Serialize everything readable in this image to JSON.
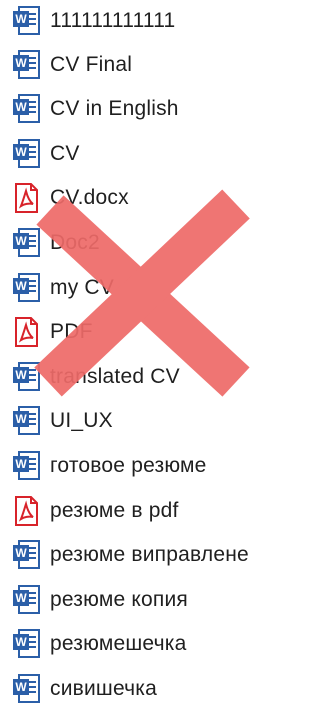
{
  "files": [
    {
      "name": "111111111111",
      "type": "word"
    },
    {
      "name": "CV Final",
      "type": "word"
    },
    {
      "name": "CV in English",
      "type": "word"
    },
    {
      "name": "CV",
      "type": "word"
    },
    {
      "name": "CV.docx",
      "type": "pdf"
    },
    {
      "name": "Doc2",
      "type": "word"
    },
    {
      "name": "my CV",
      "type": "word"
    },
    {
      "name": "PDF",
      "type": "pdf"
    },
    {
      "name": "translated CV",
      "type": "word"
    },
    {
      "name": "UI_UX",
      "type": "word"
    },
    {
      "name": "готовое резюме",
      "type": "word"
    },
    {
      "name": "резюме в pdf",
      "type": "pdf"
    },
    {
      "name": "резюме виправлене",
      "type": "word"
    },
    {
      "name": "резюме копия",
      "type": "word"
    },
    {
      "name": "резюмешечка",
      "type": "word"
    },
    {
      "name": "сивишечка",
      "type": "word"
    }
  ],
  "overlay": {
    "icon": "red-x-cross",
    "color": "#ee6a68"
  },
  "colors": {
    "word_blue": "#2b5fa8",
    "pdf_red": "#d8232a"
  }
}
